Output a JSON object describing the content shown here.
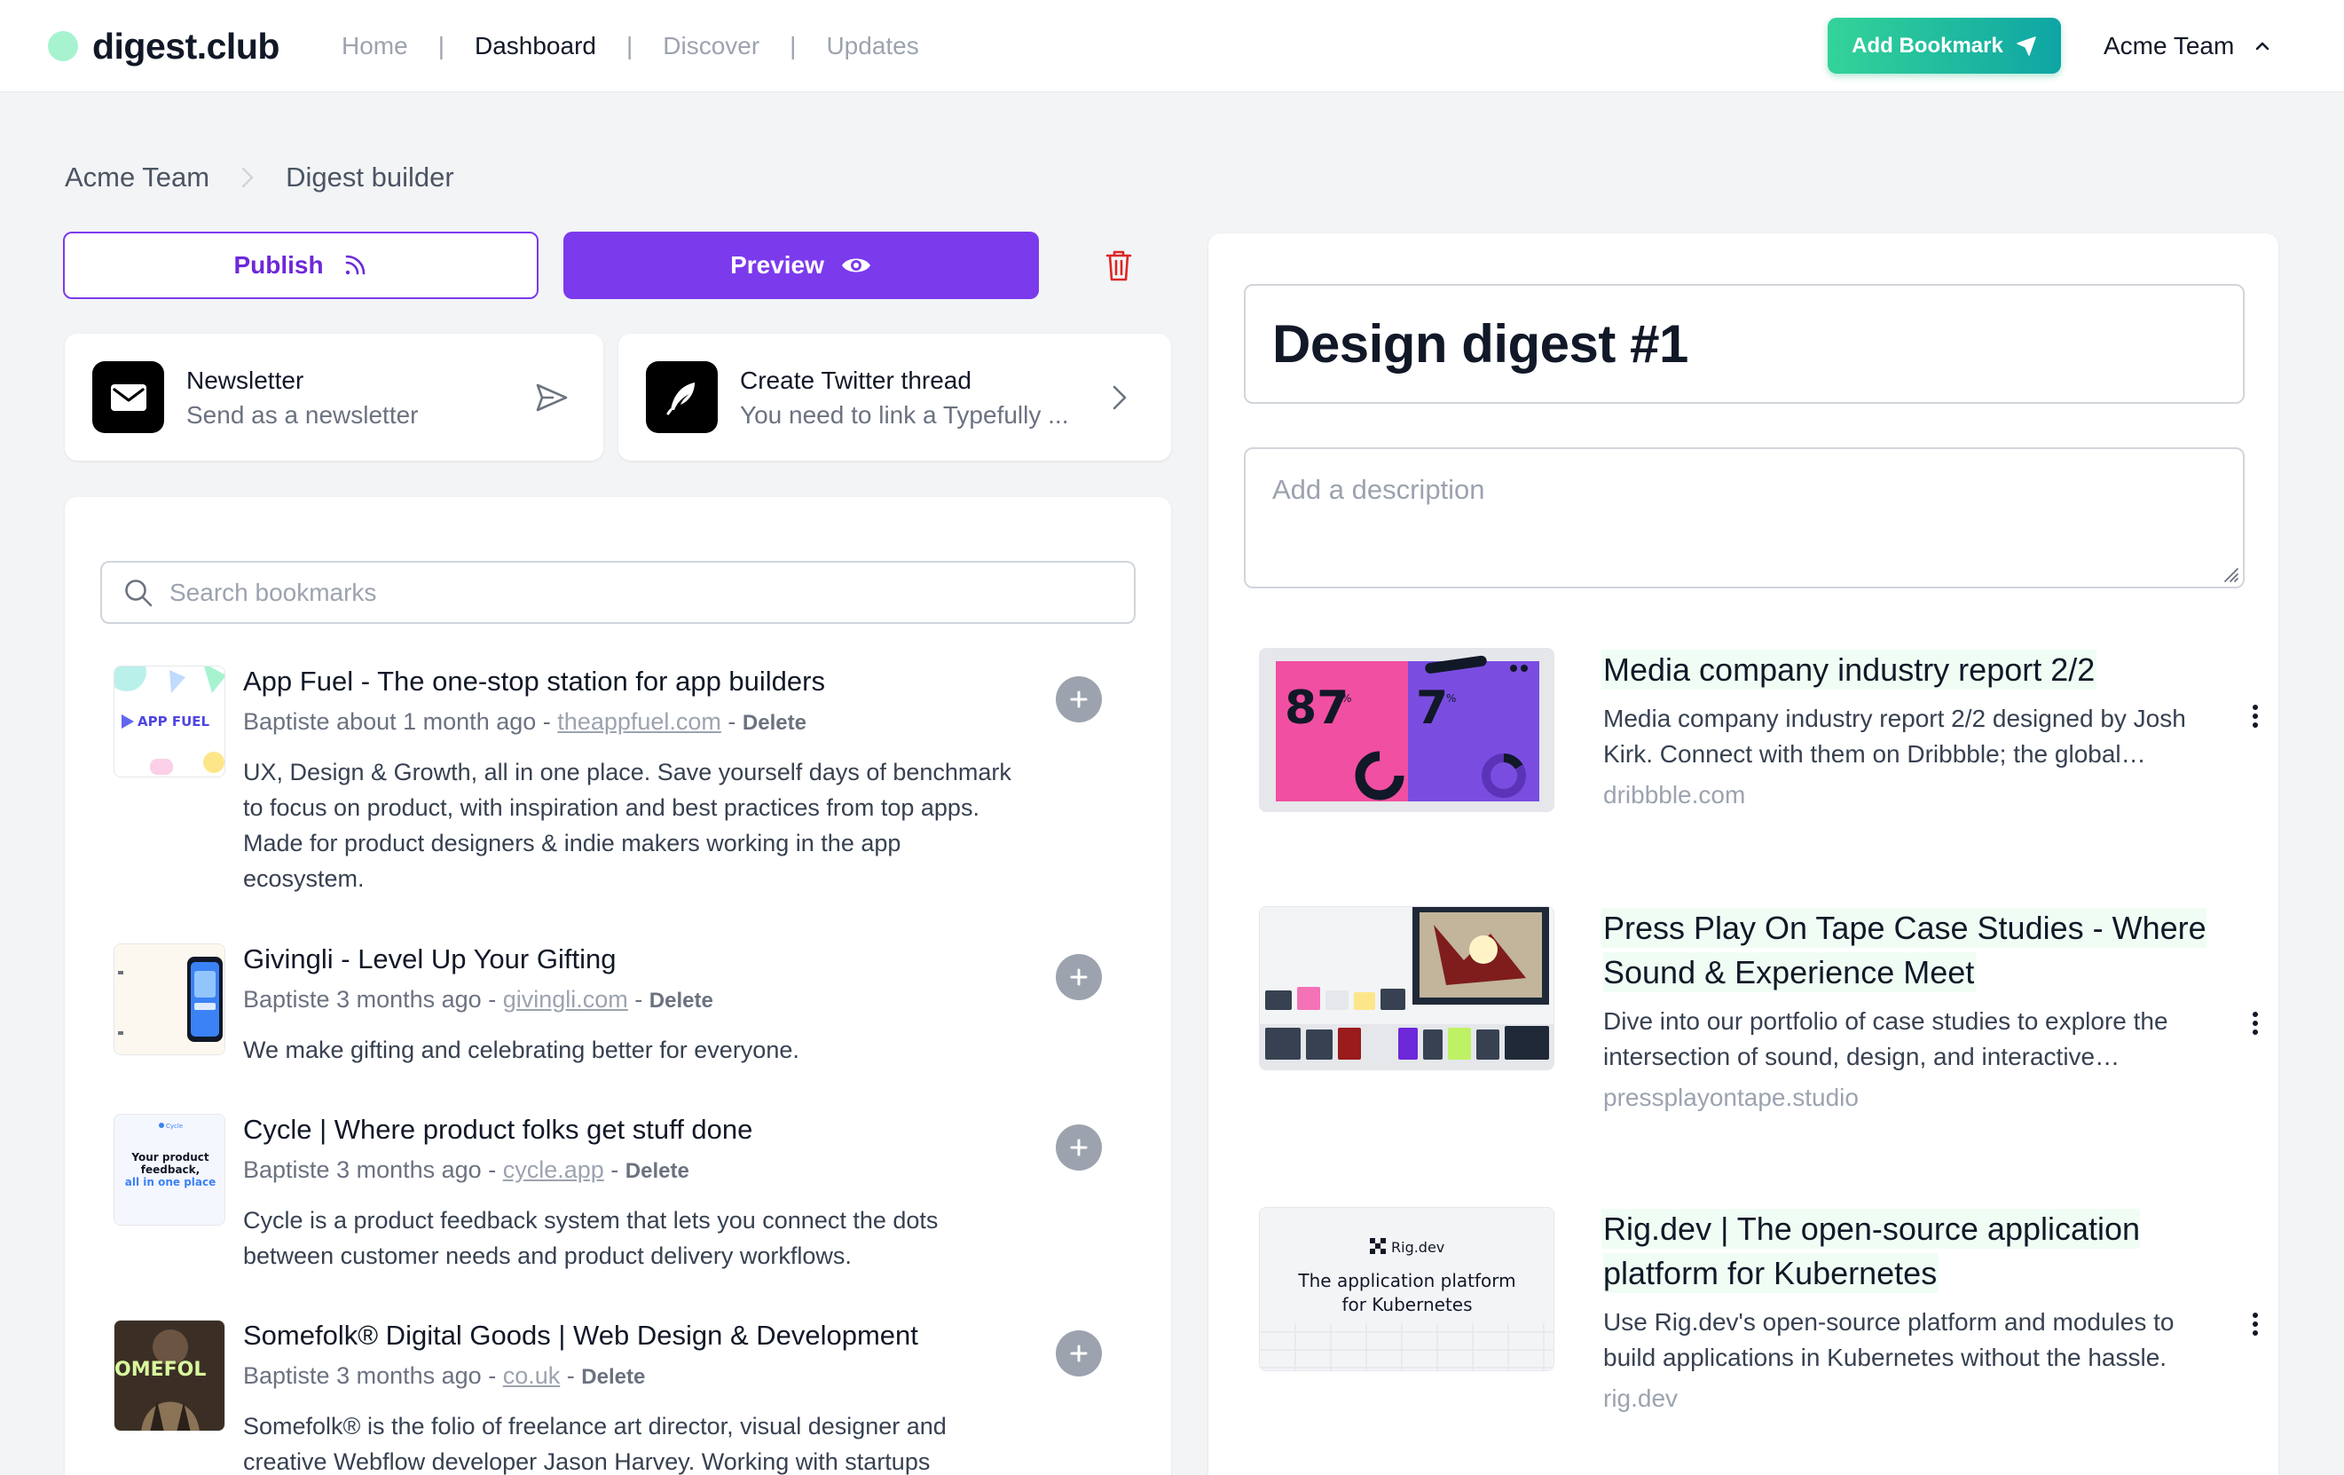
{
  "app": {
    "logo_text": "digest.club",
    "nav": [
      "Home",
      "Dashboard",
      "Discover",
      "Updates"
    ],
    "nav_separator": "|",
    "add_bookmark_label": "Add Bookmark",
    "team_name": "Acme Team"
  },
  "breadcrumb": [
    "Acme Team",
    "Digest builder"
  ],
  "actions": {
    "publish_label": "Publish",
    "preview_label": "Preview"
  },
  "share": {
    "newsletter": {
      "title": "Newsletter",
      "subtitle": "Send as a newsletter"
    },
    "twitter": {
      "title": "Create Twitter thread",
      "subtitle": "You need to link a Typefully ..."
    }
  },
  "search": {
    "placeholder": "Search bookmarks",
    "value": ""
  },
  "bookmarks": [
    {
      "title": "App Fuel - The one-stop station for app builders",
      "author": "Baptiste",
      "time": "about 1 month ago",
      "domain": "theappfuel.com",
      "delete_label": "Delete",
      "description": "UX, Design & Growth, all in one place. Save yourself days of benchmark to focus on product, with inspiration and best practices from top apps. Made for product designers & indie makers working in the app ecosystem.",
      "thumb_text": "APP FUEL"
    },
    {
      "title": "Givingli - Level Up Your Gifting",
      "author": "Baptiste",
      "time": "3 months ago",
      "domain": "givingli.com",
      "delete_label": "Delete",
      "description": "We make gifting and celebrating better for everyone."
    },
    {
      "title": "Cycle | Where product folks get stuff done",
      "author": "Baptiste",
      "time": "3 months ago",
      "domain": "cycle.app",
      "delete_label": "Delete",
      "description": "Cycle is a product feedback system that lets you connect the dots between customer needs and product delivery workflows.",
      "thumb_brand": "Cycle",
      "thumb_line1": "Your product",
      "thumb_line2": "feedback,",
      "thumb_line3": "all in one place"
    },
    {
      "title": "Somefolk® Digital Goods | Web Design & Development",
      "author": "Baptiste",
      "time": "3 months ago",
      "domain": "co.uk",
      "delete_label": "Delete",
      "description": "Somefolk® is the folio of freelance art director, visual designer and creative Webflow developer Jason Harvey. Working with startups",
      "thumb_text": "OMEFOL"
    }
  ],
  "digest": {
    "title": "Design digest #1",
    "description_placeholder": "Add a description",
    "items": [
      {
        "title": "Media company industry report 2/2",
        "description": "Media company industry report 2/2 designed by Josh Kirk. Connect with them on Dribbble; the global community for designers and creative professionals.",
        "domain": "dribbble.com",
        "thumb_left_value": "87",
        "thumb_right_value": "7",
        "thumb_unit": "%"
      },
      {
        "title": "Press Play On Tape Case Studies - Where Sound & Experience Meet",
        "description": "Dive into our portfolio of case studies to explore the intersection of sound, design, and interactive experiences.",
        "domain": "pressplayontape.studio"
      },
      {
        "title": "Rig.dev | The open-source application platform for Kubernetes",
        "description": "Use Rig.dev's open-source platform and modules to build applications in Kubernetes without the hassle.",
        "domain": "rig.dev",
        "thumb_brand": "Rig.dev",
        "thumb_line1": "The application platform",
        "thumb_line2": "for Kubernetes"
      }
    ]
  },
  "colors": {
    "primary": "#7c3aed",
    "accent_green": "#10b981",
    "danger": "#dc2626",
    "gray": "#9ca3af"
  }
}
